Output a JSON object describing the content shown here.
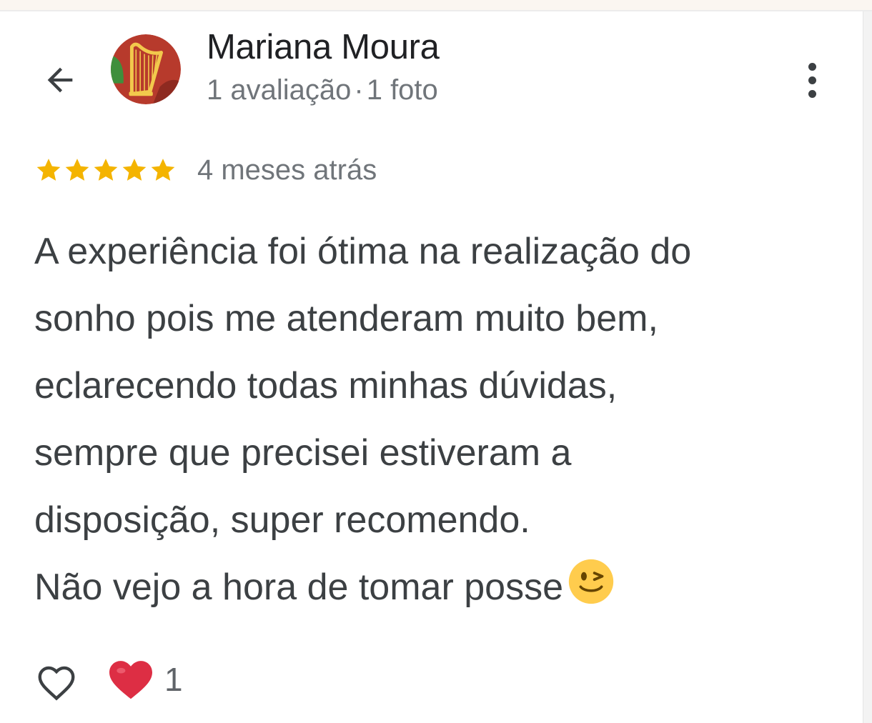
{
  "header": {
    "back_icon": "arrow-back-icon",
    "author_name": "Mariana Moura",
    "reviews_count": "1 avaliação",
    "separator": "·",
    "photos_count": "1 foto",
    "avatar_icon": "harp-avatar",
    "more_icon": "more-vertical-icon"
  },
  "rating": {
    "stars": 5,
    "max_stars": 5,
    "star_color": "#f4b400",
    "time_ago": "4 meses atrás"
  },
  "review": {
    "lines": [
      "A experiência foi ótima na realização do",
      "sonho pois me atenderam muito bem,",
      "eclarecendo todas minhas dúvidas,",
      "sempre que precisei estiveram a",
      "disposição, super recomendo.",
      "Não vejo a hora de tomar posse"
    ],
    "emoji": "winking-face-emoji"
  },
  "footer": {
    "like_icon": "heart-outline-icon",
    "reaction_icon": "red-heart-emoji",
    "reaction_count": "1"
  }
}
